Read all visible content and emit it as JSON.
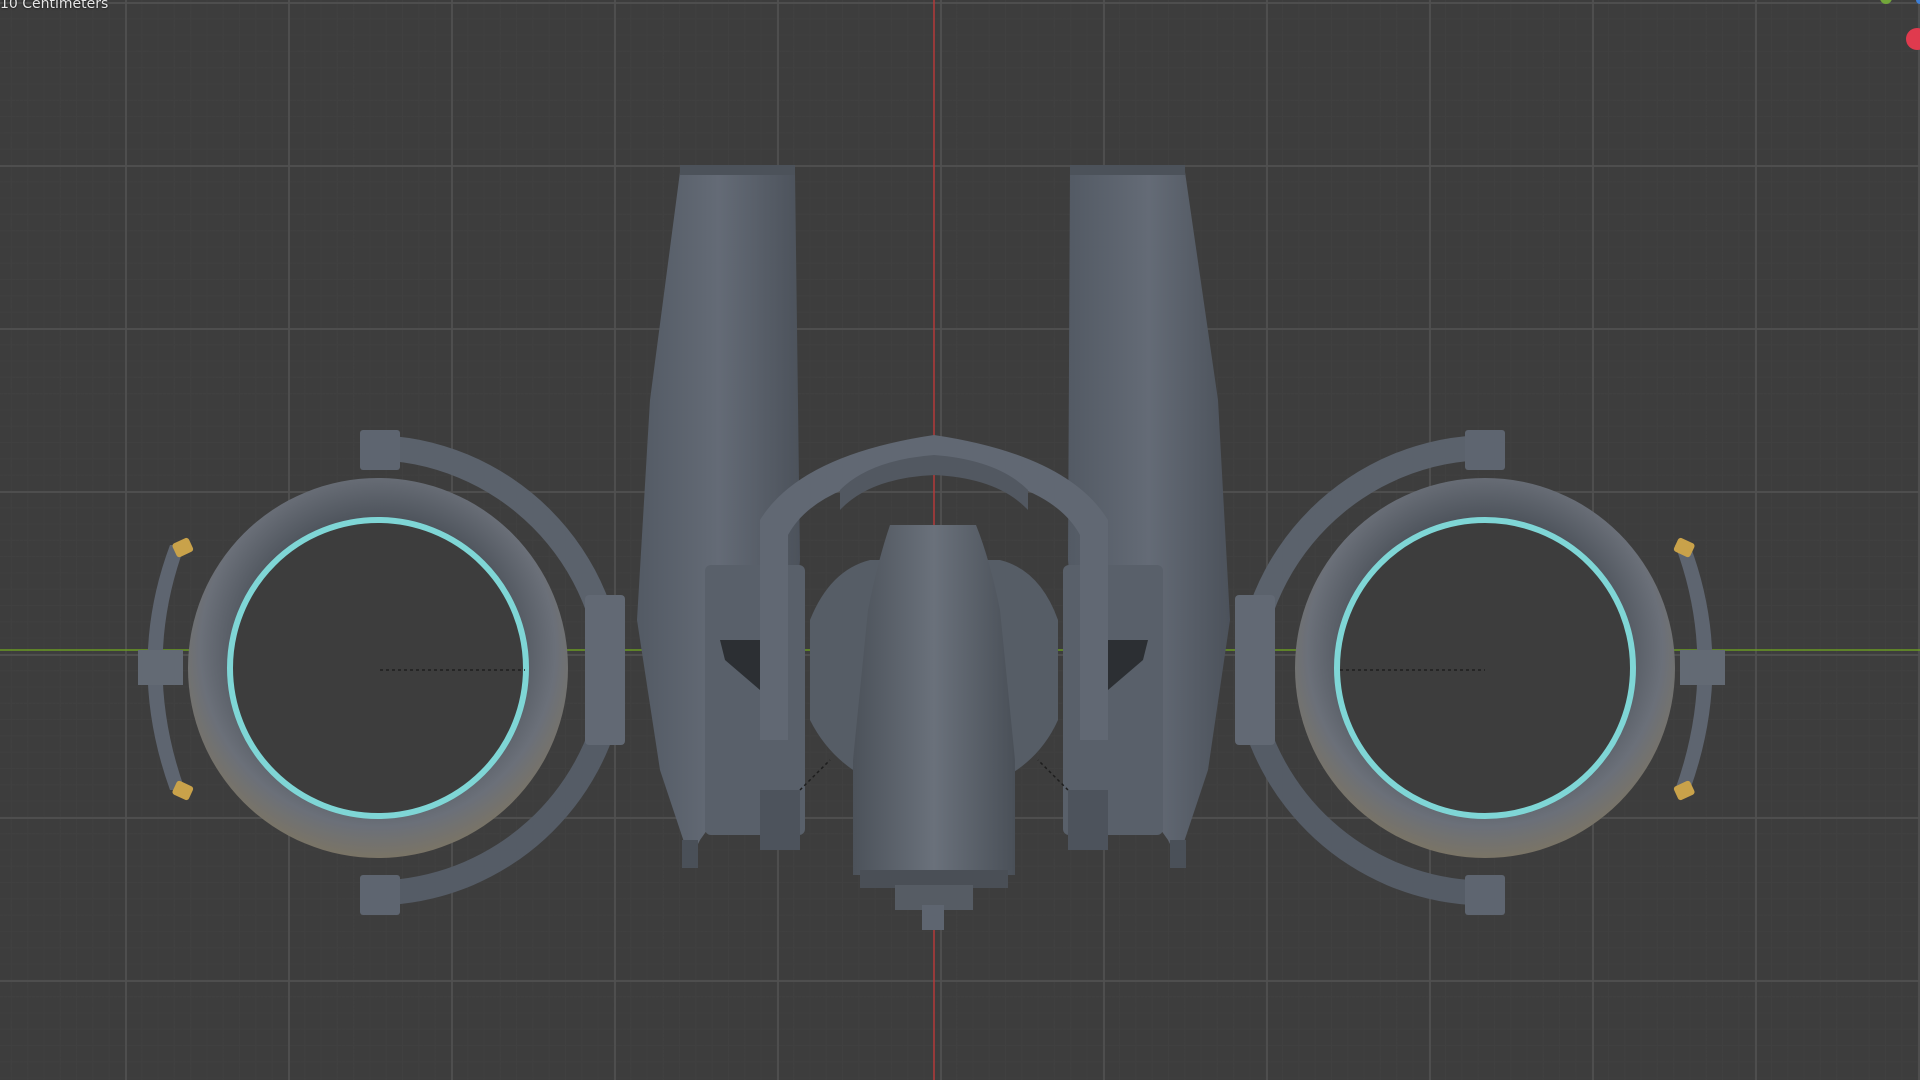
{
  "viewport": {
    "unit_label": "10 Centimeters",
    "colors": {
      "background": "#3d3d3d",
      "axis_x": "#6a9a23",
      "axis_z": "#b33a3a",
      "hull": "#5e6570",
      "hull_dark": "#3e434b",
      "ring_glow": "#7fd6d6",
      "accent_gold": "#c9a24a",
      "gizmo_red": "#e03a4e",
      "gizmo_green": "#72a63a",
      "gizmo_blue": "#3d7fd6"
    }
  },
  "scene": {
    "object": "spaceship-model",
    "view": "front-orthographic"
  }
}
